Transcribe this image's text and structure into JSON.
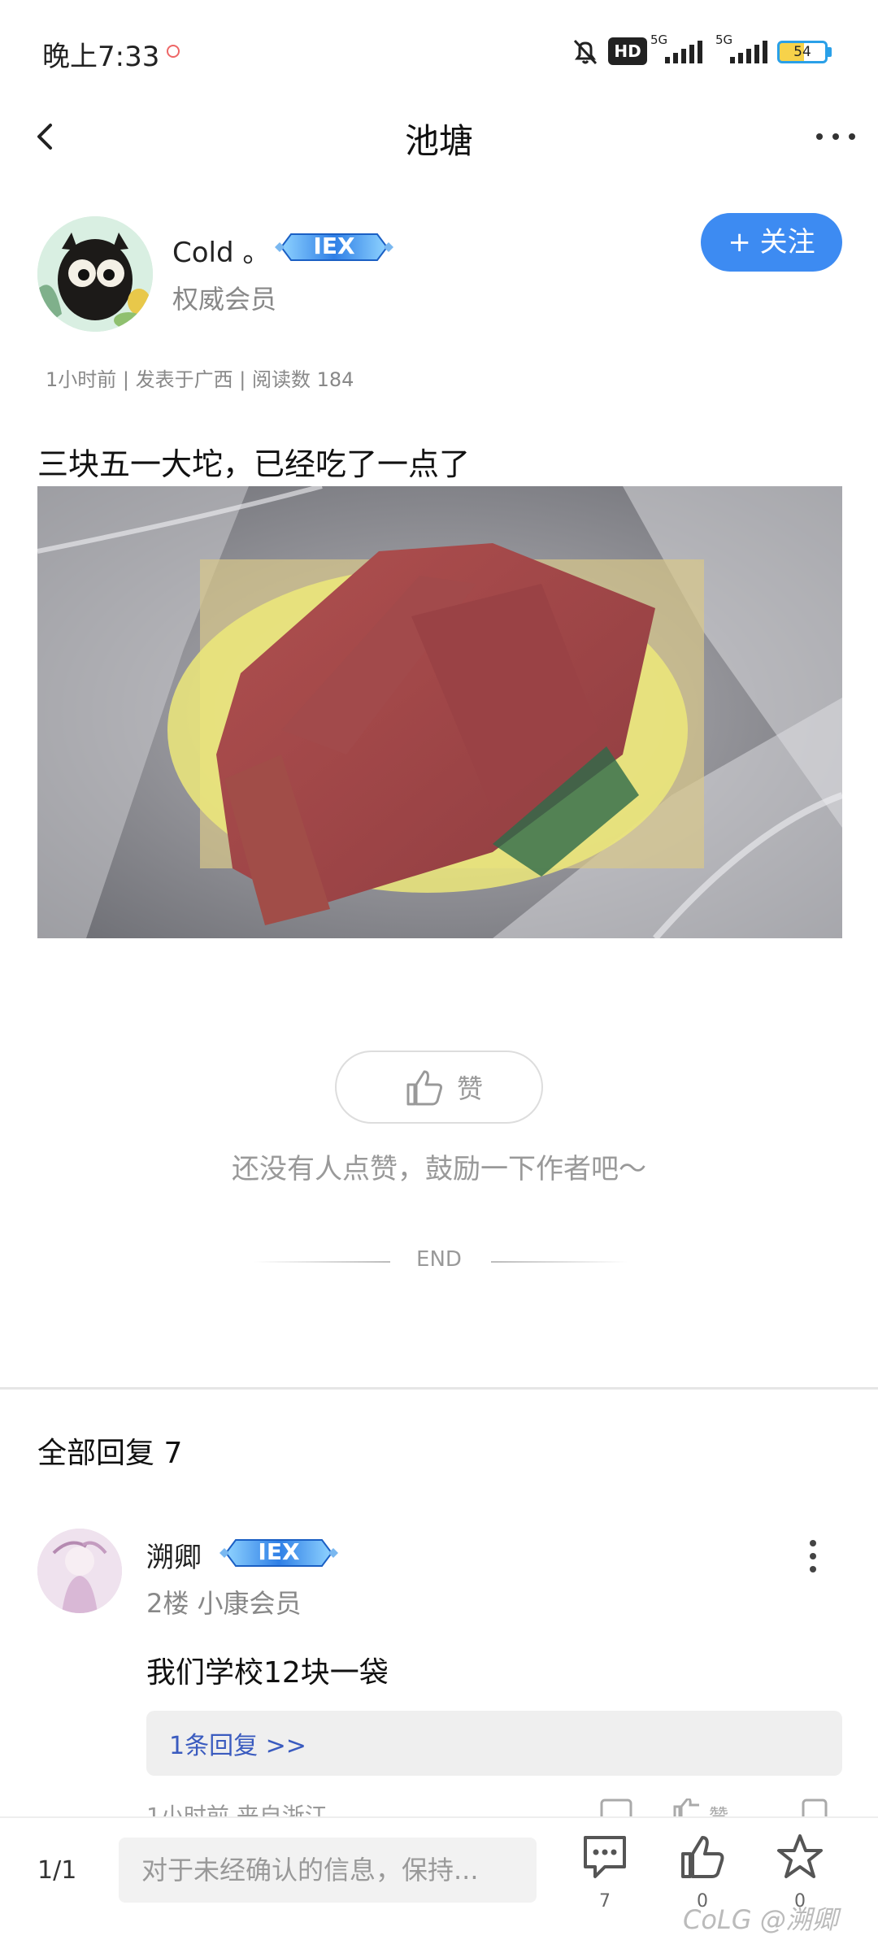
{
  "status_bar": {
    "time": "晚上7:33",
    "hd": "HD",
    "net1": "5G",
    "net2": "5G",
    "battery": "54"
  },
  "header": {
    "title": "池塘"
  },
  "author": {
    "name": "Cold 。",
    "badge": "IEX",
    "role": "权威会员",
    "follow_label": "+ 关注"
  },
  "post": {
    "meta": "1小时前 | 发表于广西 | 阅读数 184",
    "text": "三块五一大坨，已经吃了一点了",
    "like_label": "赞",
    "like_hint": "还没有人点赞，鼓励一下作者吧～",
    "end_label": "END"
  },
  "replies": {
    "title": "全部回复  7",
    "items": [
      {
        "name": "溯卿",
        "badge": "IEX",
        "meta": "2楼 小康会员",
        "text": "我们学校12块一袋",
        "reply_link": "1条回复 >>",
        "footer": "1小时前 来自浙江",
        "like_word": "赞"
      }
    ]
  },
  "bottom_bar": {
    "page": "1/1",
    "input_placeholder": "对于未经确认的信息，保持...",
    "comment_count": "7",
    "like_count": "0",
    "fav_count": "0",
    "watermark": "CoLG @溯卿"
  },
  "colors": {
    "accent": "#3d8bf2",
    "reply_link": "#3a5bbf",
    "battery_fill": "#f7d24a"
  }
}
